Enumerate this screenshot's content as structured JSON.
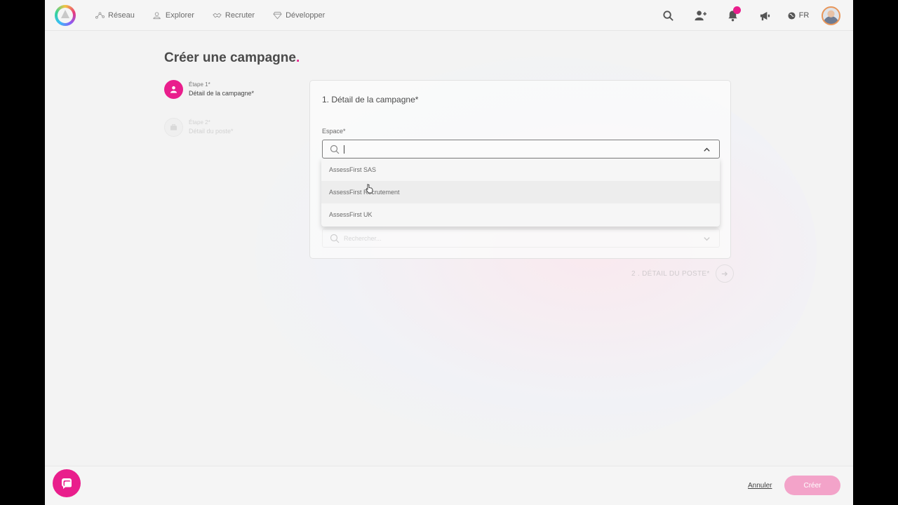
{
  "nav": {
    "items": [
      {
        "label": "Réseau",
        "icon": "network-icon"
      },
      {
        "label": "Explorer",
        "icon": "user-search-icon"
      },
      {
        "label": "Recruter",
        "icon": "handshake-icon"
      },
      {
        "label": "Développer",
        "icon": "diamond-icon"
      }
    ],
    "language": "FR"
  },
  "page": {
    "title": "Créer une campagne",
    "title_dot": "."
  },
  "steps": [
    {
      "kicker": "Étape 1*",
      "label": "Détail de la campagne*"
    },
    {
      "kicker": "Étape 2*",
      "label": "Détail du poste*"
    }
  ],
  "card": {
    "title": "1. Détail de la campagne*",
    "space_label": "Espace*",
    "space_value": "",
    "second_placeholder": "Rechercher..."
  },
  "dropdown": {
    "options": [
      "AssessFirst SAS",
      "AssessFirst Recrutement",
      "AssessFirst UK"
    ]
  },
  "next_step": {
    "label": "2 . DÉTAIL DU POSTE*"
  },
  "footer": {
    "cancel_label": "Annuler",
    "create_label": "Créer"
  },
  "colors": {
    "accent": "#e91e8c",
    "accent_light": "#f3a3c9",
    "background": "#f3f3f3"
  }
}
